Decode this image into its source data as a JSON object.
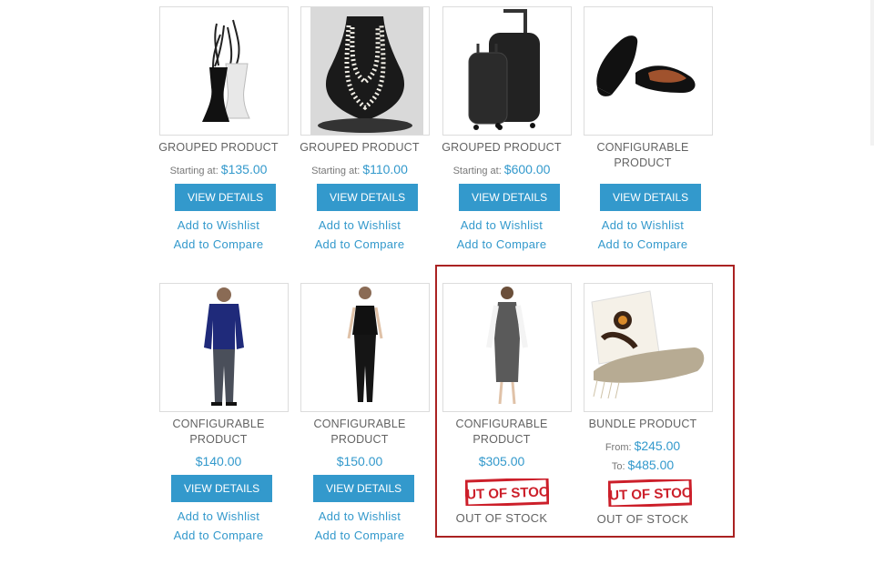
{
  "row1": [
    {
      "name": "GROUPED PRODUCT",
      "price_label": "Starting at:",
      "price": "$135.00",
      "button": "VIEW DETAILS",
      "wishlist": "Add to Wishlist",
      "compare": "Add to Compare",
      "image": "vase-with-branches"
    },
    {
      "name": "GROUPED PRODUCT",
      "price_label": "Starting at:",
      "price": "$110.00",
      "button": "VIEW DETAILS",
      "wishlist": "Add to Wishlist",
      "compare": "Add to Compare",
      "image": "pearl-necklace"
    },
    {
      "name": "GROUPED PRODUCT",
      "price_label": "Starting at:",
      "price": "$600.00",
      "button": "VIEW DETAILS",
      "wishlist": "Add to Wishlist",
      "compare": "Add to Compare",
      "image": "luggage-set"
    },
    {
      "name_line1": "CONFIGURABLE",
      "name_line2": "PRODUCT",
      "button": "VIEW DETAILS",
      "wishlist": "Add to Wishlist",
      "compare": "Add to Compare",
      "image": "black-flats"
    }
  ],
  "row2": [
    {
      "name_line1": "CONFIGURABLE",
      "name_line2": "PRODUCT",
      "price": "$140.00",
      "button": "VIEW DETAILS",
      "wishlist": "Add to Wishlist",
      "compare": "Add to Compare",
      "image": "man-blue-shirt"
    },
    {
      "name_line1": "CONFIGURABLE",
      "name_line2": "PRODUCT",
      "price": "$150.00",
      "button": "VIEW DETAILS",
      "wishlist": "Add to Wishlist",
      "compare": "Add to Compare",
      "image": "woman-black-top"
    },
    {
      "name_line1": "CONFIGURABLE",
      "name_line2": "PRODUCT",
      "price": "$305.00",
      "stamp": "OUT OF STOCK",
      "stock": "OUT OF STOCK",
      "image": "woman-dress"
    },
    {
      "name": "BUNDLE PRODUCT",
      "from_label": "From:",
      "from_price": "$245.00",
      "to_label": "To:",
      "to_price": "$485.00",
      "stamp": "OUT OF STOCK",
      "stock": "OUT OF STOCK",
      "image": "pillow-and-throw"
    }
  ],
  "colors": {
    "accent": "#3399cc",
    "highlight_border": "#aa2222",
    "stamp_red": "#cc1f2a"
  }
}
